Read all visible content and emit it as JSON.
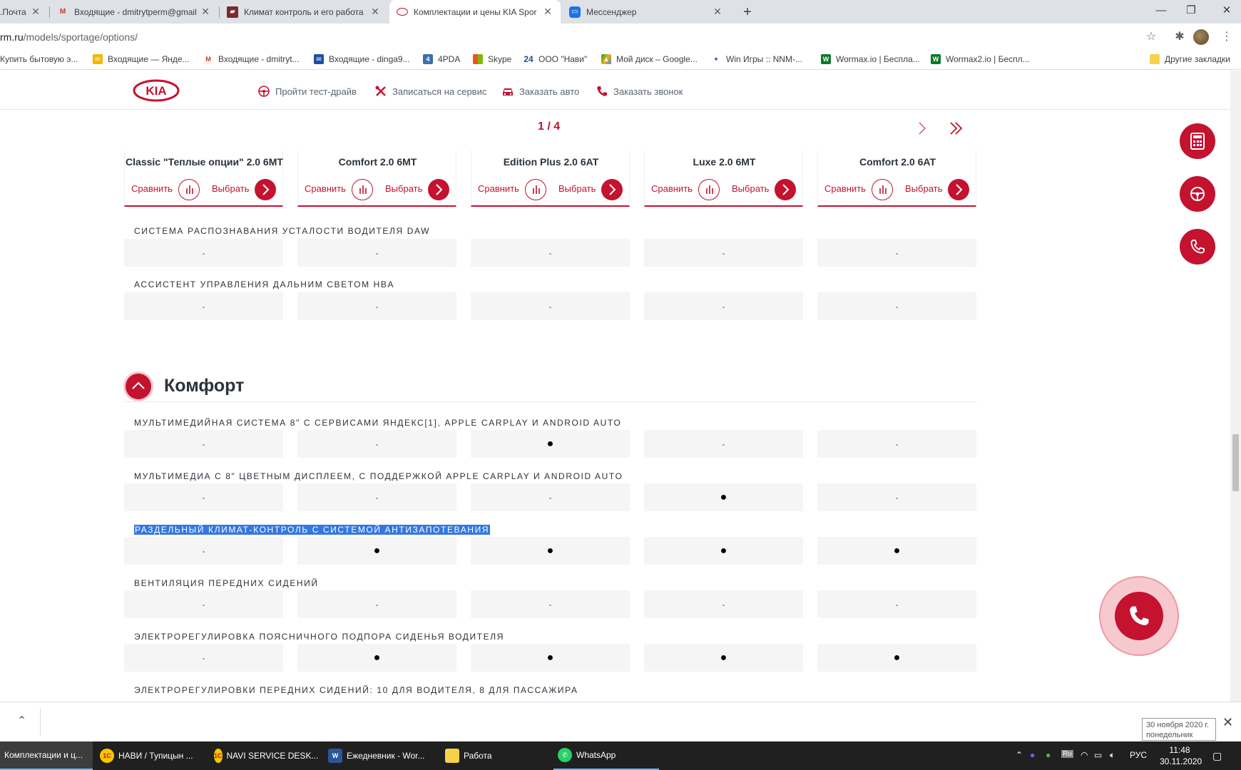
{
  "browser": {
    "tabs": [
      {
        "title": ".Почта",
        "active": false
      },
      {
        "title": "Входящие - dmitrytperm@gmail",
        "active": false
      },
      {
        "title": "Климат контроль и его работа",
        "active": false
      },
      {
        "title": "Комплектации и цены KIA Spor",
        "active": true
      },
      {
        "title": "Мессенджер",
        "active": false
      }
    ],
    "url_host": "rm.ru",
    "url_path": "/models/sportage/options/",
    "bookmarks": [
      "Купить бытовую э...",
      "Входящие — Янде...",
      "Входящие - dmitryt...",
      "Входящие - dinga9...",
      "4PDA",
      "Skype",
      "ООО \"Нави\"",
      "Мой диск – Google...",
      "Win Игры :: NNM-...",
      "Wormax.io | Беспла...",
      "Wormax2.io | Беспл...",
      "Другие закладки"
    ]
  },
  "site": {
    "nav": {
      "test_drive": "Пройти тест-драйв",
      "service": "Записаться на сервис",
      "order_car": "Заказать авто",
      "callback": "Заказать звонок"
    },
    "pager": "1 / 4",
    "compare_label": "Сравнить",
    "choose_label": "Выбрать",
    "columns": [
      {
        "name": "Classic \"Теплые опции\" 2.0 6MT"
      },
      {
        "name": "Comfort 2.0 6MT"
      },
      {
        "name": "Edition Plus 2.0 6AT"
      },
      {
        "name": "Luxe 2.0 6MT"
      },
      {
        "name": "Comfort 2.0 6AT"
      }
    ],
    "safety_features": [
      {
        "label": "СИСТЕМА РАСПОЗНАВАНИЯ УСТАЛОСТИ ВОДИТЕЛЯ DAW",
        "values": [
          "-",
          "-",
          "-",
          "-",
          "-"
        ]
      },
      {
        "label": "АССИСТЕНТ УПРАВЛЕНИЯ ДАЛЬНИМ СВЕТОМ HBA",
        "values": [
          "-",
          "-",
          "-",
          "-",
          "-"
        ]
      }
    ],
    "section_title": "Комфорт",
    "comfort_features": [
      {
        "label": "МУЛЬТИМЕДИЙНАЯ СИСТЕМА 8\" С СЕРВИСАМИ ЯНДЕКС[1], APPLE CARPLAY И ANDROID AUTO",
        "values": [
          "-",
          "-",
          "●",
          "-",
          "-"
        ],
        "selected": false
      },
      {
        "label": "МУЛЬТИМЕДИА С 8\" ЦВЕТНЫМ ДИСПЛЕЕМ, С ПОДДЕРЖКОЙ APPLE CARPLAY И ANDROID AUTO",
        "values": [
          "-",
          "-",
          "-",
          "●",
          "-"
        ],
        "selected": false
      },
      {
        "label": "РАЗДЕЛЬНЫЙ КЛИМАТ-КОНТРОЛЬ С СИСТЕМОЙ АНТИЗАПОТЕВАНИЯ",
        "values": [
          "-",
          "●",
          "●",
          "●",
          "●"
        ],
        "selected": true
      },
      {
        "label": "ВЕНТИЛЯЦИЯ ПЕРЕДНИХ СИДЕНИЙ",
        "values": [
          "-",
          "-",
          "-",
          "-",
          "-"
        ],
        "selected": false
      },
      {
        "label": "ЭЛЕКТРОРЕГУЛИРОВКА ПОЯСНИЧНОГО ПОДПОРА СИДЕНЬЯ ВОДИТЕЛЯ",
        "values": [
          "-",
          "●",
          "●",
          "●",
          "●"
        ],
        "selected": false
      },
      {
        "label": "ЭЛЕКТРОРЕГУЛИРОВКИ ПЕРЕДНИХ СИДЕНИЙ: 10 ДЛЯ ВОДИТЕЛЯ, 8 ДЛЯ ПАССАЖИРА",
        "values": [],
        "selected": false
      }
    ],
    "brand_color": "#c4122f"
  },
  "shelf": {
    "tooltip_line1": "30 ноября 2020 г.",
    "tooltip_line2": "понедельник"
  },
  "taskbar": {
    "items": [
      {
        "label": "Комплектации и ц...",
        "active": true
      },
      {
        "label": "НАВИ / Тупицын ...",
        "active": false
      },
      {
        "label": "NAVI SERVICE DESK...",
        "active": false
      },
      {
        "label": "Ежедневник - Wor...",
        "active": false
      },
      {
        "label": "Работа",
        "active": false
      },
      {
        "label": "WhatsApp",
        "active": false
      }
    ],
    "lang": "РУС",
    "time": "11:48",
    "date": "30.11.2020"
  }
}
